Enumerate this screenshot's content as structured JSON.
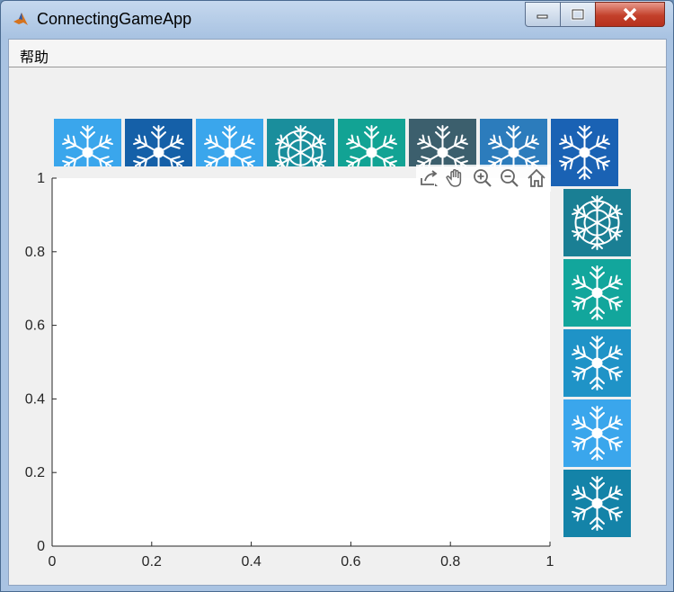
{
  "window": {
    "title": "ConnectingGameApp",
    "controls": [
      "minimize",
      "maximize",
      "close"
    ]
  },
  "menu": {
    "items": [
      {
        "label": "帮助"
      }
    ]
  },
  "tiles": {
    "top": [
      {
        "icon": "snowflake-icon",
        "bg": "#3aa6ec"
      },
      {
        "icon": "snowflake-icon",
        "bg": "#1560a8"
      },
      {
        "icon": "snowflake-icon",
        "bg": "#3aa6ec"
      },
      {
        "icon": "mandala-snowflake-icon",
        "bg": "#1a8e9c"
      },
      {
        "icon": "snowflake-icon",
        "bg": "#12a394"
      },
      {
        "icon": "snowflake-icon",
        "bg": "#3c5f6d"
      },
      {
        "icon": "snowflake-icon",
        "bg": "#2c7cbc"
      },
      {
        "icon": "snowflake-icon",
        "bg": "#1a62b4"
      }
    ],
    "right": [
      {
        "icon": "mandala-snowflake-icon",
        "bg": "#1a7f94"
      },
      {
        "icon": "snowflake-icon",
        "bg": "#12a69c"
      },
      {
        "icon": "snowflake-icon",
        "bg": "#1f93c7"
      },
      {
        "icon": "snowflake-icon",
        "bg": "#3aa6ec"
      },
      {
        "icon": "snowflake-icon",
        "bg": "#1483a8"
      }
    ]
  },
  "axes_toolbar": [
    "export-icon",
    "pan-hand-icon",
    "zoom-in-icon",
    "zoom-out-icon",
    "home-icon"
  ],
  "chart_data": {
    "type": "line",
    "series": [],
    "xlim": [
      0,
      1
    ],
    "ylim": [
      0,
      1
    ],
    "xticks": [
      "0",
      "0.2",
      "0.4",
      "0.6",
      "0.8",
      "1"
    ],
    "yticks": [
      "0",
      "0.2",
      "0.4",
      "0.6",
      "0.8",
      "1"
    ],
    "grid": false
  }
}
